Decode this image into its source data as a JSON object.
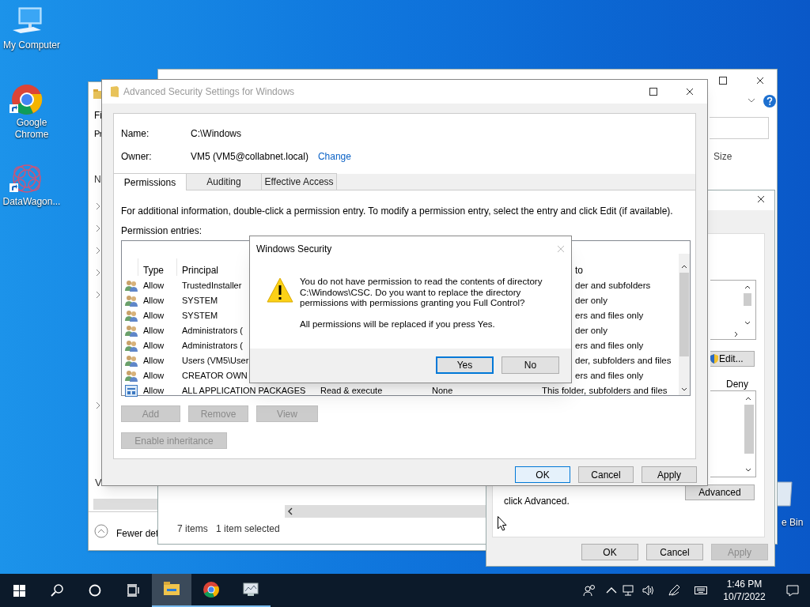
{
  "desktop_icons": [
    {
      "kind": "computer",
      "label": "My Computer"
    },
    {
      "kind": "chrome",
      "label": "Google Chrome"
    },
    {
      "kind": "app",
      "label": "DataWagon..."
    }
  ],
  "recycle_bin": {
    "label": "e Bin"
  },
  "back_window": {
    "menu_fragment": "Fi",
    "tab_fragment": "Pr",
    "column_fragment": "N",
    "section_fragment": "V",
    "fewer_details": "Fewer det"
  },
  "explorer": {
    "column": "Size",
    "item_count": "7 items",
    "selection": "1 item selected"
  },
  "properties": {
    "edit_button": "Edit...",
    "deny_header": "Deny",
    "advanced_note": "click Advanced.",
    "advanced_button": "Advanced",
    "buttons": [
      {
        "label": "OK",
        "disabled": false
      },
      {
        "label": "Cancel",
        "disabled": false
      },
      {
        "label": "Apply",
        "disabled": true
      }
    ]
  },
  "advanced_security": {
    "title": "Advanced Security Settings for Windows",
    "name_label": "Name:",
    "name": "C:\\Windows",
    "owner_label": "Owner:",
    "owner": "VM5 (VM5@collabnet.local)",
    "change_link": "Change",
    "tabs": [
      {
        "label": "Permissions",
        "selected": true
      },
      {
        "label": "Auditing",
        "selected": false
      },
      {
        "label": "Effective Access",
        "selected": false
      }
    ],
    "info": "For additional information, double-click a permission entry. To modify a permission entry, select the entry and click Edit (if available).",
    "entries_label": "Permission entries:",
    "columns": [
      "Type",
      "Principal"
    ],
    "applies_header": "to",
    "entries": [
      {
        "kind": "group",
        "type": "Allow",
        "principal": "TrustedInstaller",
        "applies_to": "der and subfolders"
      },
      {
        "kind": "group",
        "type": "Allow",
        "principal": "SYSTEM",
        "applies_to": "der only"
      },
      {
        "kind": "group",
        "type": "Allow",
        "principal": "SYSTEM",
        "applies_to": "ers and files only"
      },
      {
        "kind": "group",
        "type": "Allow",
        "principal": "Administrators (",
        "applies_to": "der only"
      },
      {
        "kind": "group",
        "type": "Allow",
        "principal": "Administrators (",
        "applies_to": "ers and files only"
      },
      {
        "kind": "group",
        "type": "Allow",
        "principal": "Users (VM5\\User",
        "applies_to": "der, subfolders and files"
      },
      {
        "kind": "group",
        "type": "Allow",
        "principal": "CREATOR OWN",
        "applies_to": "ers and files only"
      },
      {
        "kind": "package",
        "type": "Allow",
        "principal": "ALL APPLICATION PACKAGES",
        "access": "Read & execute",
        "inherited_from": "None",
        "applies_to": "This folder, subfolders and files"
      }
    ],
    "actions": [
      {
        "label": "Add",
        "disabled": true
      },
      {
        "label": "Remove",
        "disabled": true
      },
      {
        "label": "View",
        "disabled": true
      }
    ],
    "inheritance_button": {
      "label": "Enable inheritance",
      "disabled": true
    },
    "buttons": [
      {
        "label": "OK",
        "focused": true
      },
      {
        "label": "Cancel",
        "focused": false
      },
      {
        "label": "Apply",
        "focused": false
      }
    ]
  },
  "security_prompt": {
    "title": "Windows Security",
    "message": "You do not have permission to read the contents of directory C:\\Windows\\CSC. Do you want to replace the directory permissions with permissions granting you Full Control?",
    "note": "All permissions will be replaced if you press Yes.",
    "buttons": [
      {
        "label": "Yes",
        "default": true
      },
      {
        "label": "No",
        "default": false
      }
    ]
  },
  "taskbar": {
    "apps": [
      {
        "kind": "explorer",
        "active": true
      },
      {
        "kind": "chrome",
        "active": false
      },
      {
        "kind": "monitor",
        "active": false
      }
    ],
    "time": "1:46 PM",
    "date": "10/7/2022"
  }
}
